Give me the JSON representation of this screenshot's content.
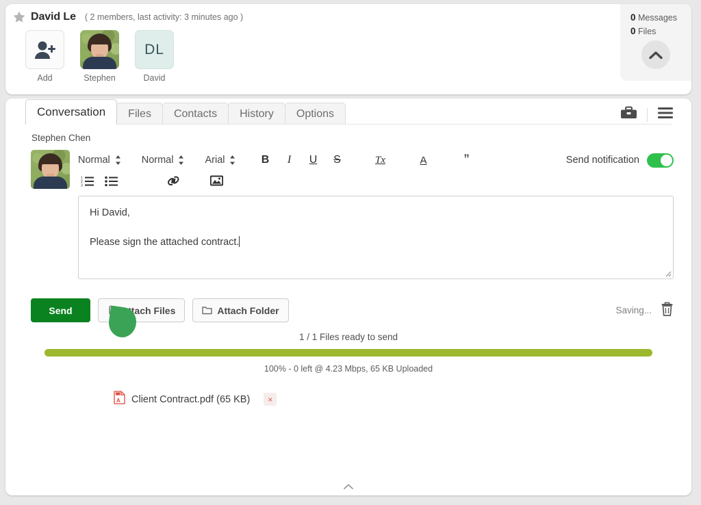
{
  "header": {
    "star_icon": "star-icon",
    "room_title": "David Le",
    "room_meta": "( 2 members, last activity: 3 minutes ago )",
    "members": [
      {
        "name": "Add",
        "type": "add",
        "icon": "person-add-icon"
      },
      {
        "name": "Stephen",
        "type": "photo",
        "icon": "avatar-photo"
      },
      {
        "name": "David",
        "type": "initials",
        "initials": "DL"
      }
    ],
    "counts": {
      "messages_count": "0",
      "messages_label": "Messages",
      "files_count": "0",
      "files_label": "Files",
      "collapse_icon": "chevron-up-icon"
    }
  },
  "tabs": [
    {
      "label": "Conversation",
      "active": true
    },
    {
      "label": "Files",
      "active": false
    },
    {
      "label": "Contacts",
      "active": false
    },
    {
      "label": "History",
      "active": false
    },
    {
      "label": "Options",
      "active": false
    }
  ],
  "tab_icons": [
    {
      "name": "briefcase-icon"
    },
    {
      "name": "hamburger-menu-icon"
    }
  ],
  "conversation": {
    "sender_name": "Stephen Chen",
    "avatar": "avatar-photo"
  },
  "toolbar": {
    "style_select": "Normal",
    "size_select": "Normal",
    "font_select": "Arial",
    "bold_label": "B",
    "italic_label": "I",
    "underline_label": "U",
    "strike_label": "S",
    "clear_format_label": "Tx",
    "font_color_label": "A",
    "quote_label": "”",
    "ordered_list_icon": "ordered-list-icon",
    "bullet_list_icon": "bullet-list-icon",
    "link_icon": "link-icon",
    "image_icon": "image-icon",
    "notification_label": "Send notification",
    "notification_on": true
  },
  "compose": {
    "line1": "Hi David,",
    "line2": "Please sign the attached contract."
  },
  "actions": {
    "send_label": "Send",
    "attach_files_label": "Attach Files",
    "attach_folder_label": "Attach Folder",
    "attach_files_icon": "paperclip-icon",
    "attach_folder_icon": "folder-icon",
    "saving_text": "Saving...",
    "delete_icon": "trash-icon"
  },
  "upload": {
    "files_ready": "1 / 1 Files ready to send",
    "progress_percent": 100,
    "status": "100% - 0 left @ 4.23 Mbps, 65 KB Uploaded",
    "bar_color": "#9cb82e"
  },
  "attachment": {
    "icon": "pdf-file-icon",
    "name": "Client Contract.pdf (65 KB)",
    "remove_label": "×"
  },
  "footer": {
    "collapse_icon": "chevron-up-small-icon"
  },
  "colors": {
    "send_green": "#0a8220",
    "toggle_green": "#2fc04c",
    "progress_olive": "#9cb82e",
    "cursor_green": "#3ba355",
    "initials_bg": "#dfeeea",
    "initials_fg": "#37565c"
  }
}
